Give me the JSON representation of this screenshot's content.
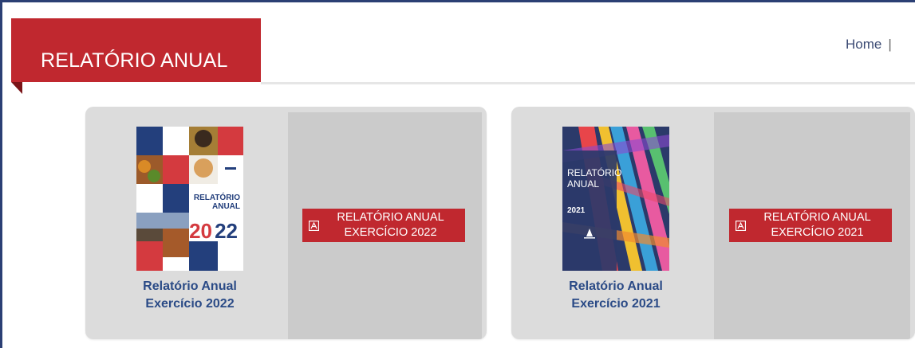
{
  "header": {
    "title": "RELATÓRIO ANUAL",
    "breadcrumb_home": "Home",
    "breadcrumb_sep": "|"
  },
  "reports": [
    {
      "caption_line1": "Relatório Anual",
      "caption_line2": "Exercício 2022",
      "button_line1": "RELATÓRIO ANUAL",
      "button_line2": "EXERCÍCIO 2022",
      "cover": {
        "title_line1": "RELATÓRIO",
        "title_line2": "ANUAL",
        "year_a": "20",
        "year_b": "22"
      }
    },
    {
      "caption_line1": "Relatório Anual",
      "caption_line2": "Exercício 2021",
      "button_line1": "RELATÓRIO ANUAL",
      "button_line2": "EXERCÍCIO 2021",
      "cover": {
        "title_line1": "RELATÓRIO",
        "title_line2": "ANUAL",
        "year": "2021"
      }
    }
  ],
  "colors": {
    "accent_red": "#c0282f",
    "navy": "#2b3f74",
    "caption_blue": "#2a4a86"
  }
}
